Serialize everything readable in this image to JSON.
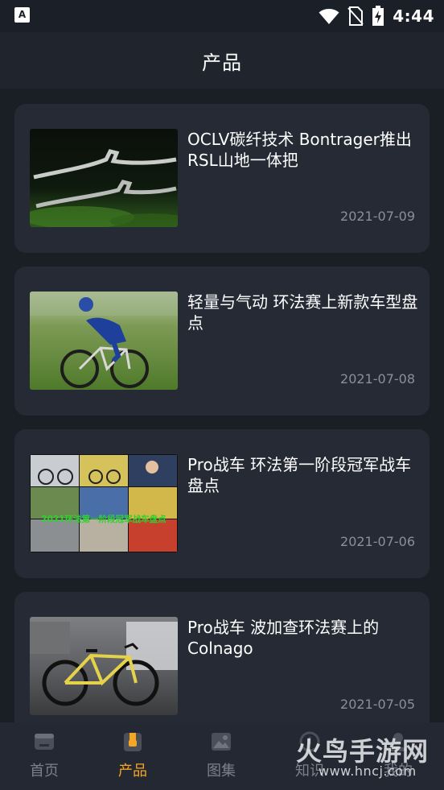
{
  "status": {
    "time": "4:44"
  },
  "header": {
    "title": "产品"
  },
  "articles": [
    {
      "title": "OCLV碳纤技术 Bontrager推出RSL山地一体把",
      "date": "2021-07-09"
    },
    {
      "title": "轻量与气动 环法赛上新款车型盘点",
      "date": "2021-07-08"
    },
    {
      "title": "Pro战车 环法第一阶段冠军战车盘点",
      "date": "2021-07-06",
      "image_caption": "2021环法第一阶段冠军战车盘点"
    },
    {
      "title": "Pro战车 波加查环法赛上的Colnago",
      "date": "2021-07-05"
    }
  ],
  "nav": {
    "home": "首页",
    "products": "产品",
    "gallery": "图集",
    "knowledge": "知识",
    "mine": "我的"
  },
  "watermark": {
    "main": "火鸟手游网",
    "sub": "www.hncj.com"
  },
  "colors": {
    "background": "#1a1e25",
    "card": "#252a34",
    "accent": "#f5a623",
    "muted_text": "#8a8f98"
  }
}
